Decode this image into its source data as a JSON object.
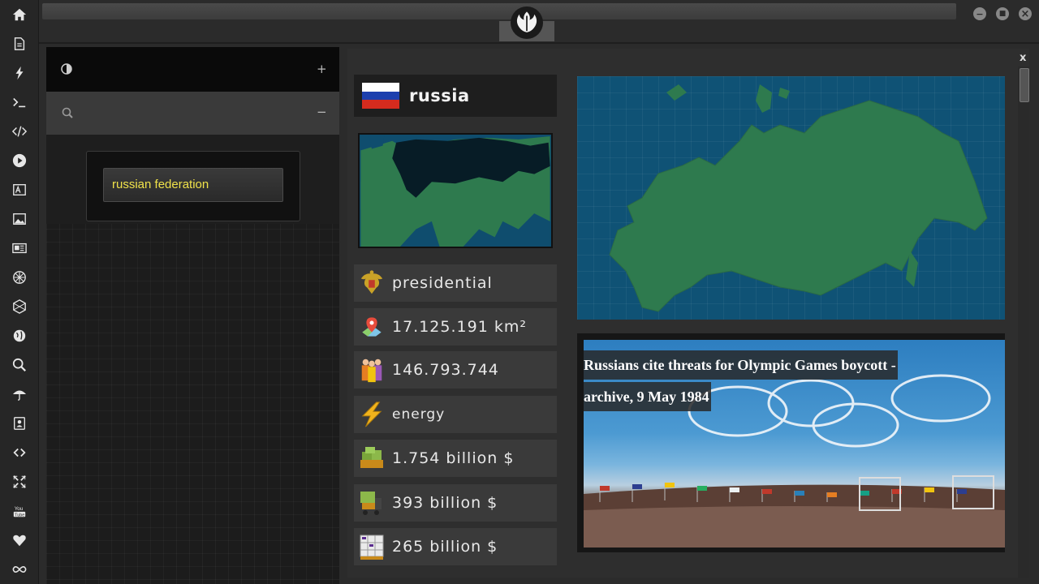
{
  "rail": {
    "items": [
      {
        "name": "home-icon",
        "glyph": "home"
      },
      {
        "name": "document-icon",
        "glyph": "doc"
      },
      {
        "name": "lightning-icon",
        "glyph": "bolt"
      },
      {
        "name": "terminal-icon",
        "glyph": ">_"
      },
      {
        "name": "code-icon",
        "glyph": "</>"
      },
      {
        "name": "play-icon",
        "glyph": "play"
      },
      {
        "name": "translate-icon",
        "glyph": "translate"
      },
      {
        "name": "image-icon",
        "glyph": "image"
      },
      {
        "name": "newspaper-icon",
        "glyph": "news"
      },
      {
        "name": "rebel-icon",
        "glyph": "rebel"
      },
      {
        "name": "hexagon-icon",
        "glyph": "hex"
      },
      {
        "name": "globe-icon",
        "glyph": "globe"
      },
      {
        "name": "search-icon",
        "glyph": "search"
      },
      {
        "name": "umbrella-icon",
        "glyph": "umbrella"
      },
      {
        "name": "contacts-icon",
        "glyph": "contacts"
      },
      {
        "name": "link-icon",
        "glyph": "link"
      },
      {
        "name": "expand-icon",
        "glyph": "expand"
      },
      {
        "name": "youtube-icon",
        "glyph": "youtube"
      },
      {
        "name": "heart-icon",
        "glyph": "heart"
      },
      {
        "name": "infinity-icon",
        "glyph": "infinity"
      }
    ]
  },
  "left_panel": {
    "contrast_icon": "contrast-icon",
    "add_label": "+",
    "collapse_label": "−",
    "search_value": "russian federation"
  },
  "country": {
    "name": "russia",
    "flag_colors": [
      "#ffffff",
      "#1c3fae",
      "#d52b1e"
    ],
    "government": "presidential",
    "area": "17.125.191 km²",
    "population": "146.793.744",
    "sector": "energy",
    "gdp": "1.754 billion $",
    "exports": "393 billion $",
    "imports": "265 billion $"
  },
  "news": {
    "title": "Russians cite threats for Olympic Games boycott - archive, 9 May 1984"
  },
  "window": {
    "close_label": "x",
    "minimize": "−",
    "maximize": "■",
    "exit": "×"
  },
  "colors": {
    "accent_text": "#f0e24a",
    "land": "#2e7a4e",
    "sea": "#0f5275"
  }
}
